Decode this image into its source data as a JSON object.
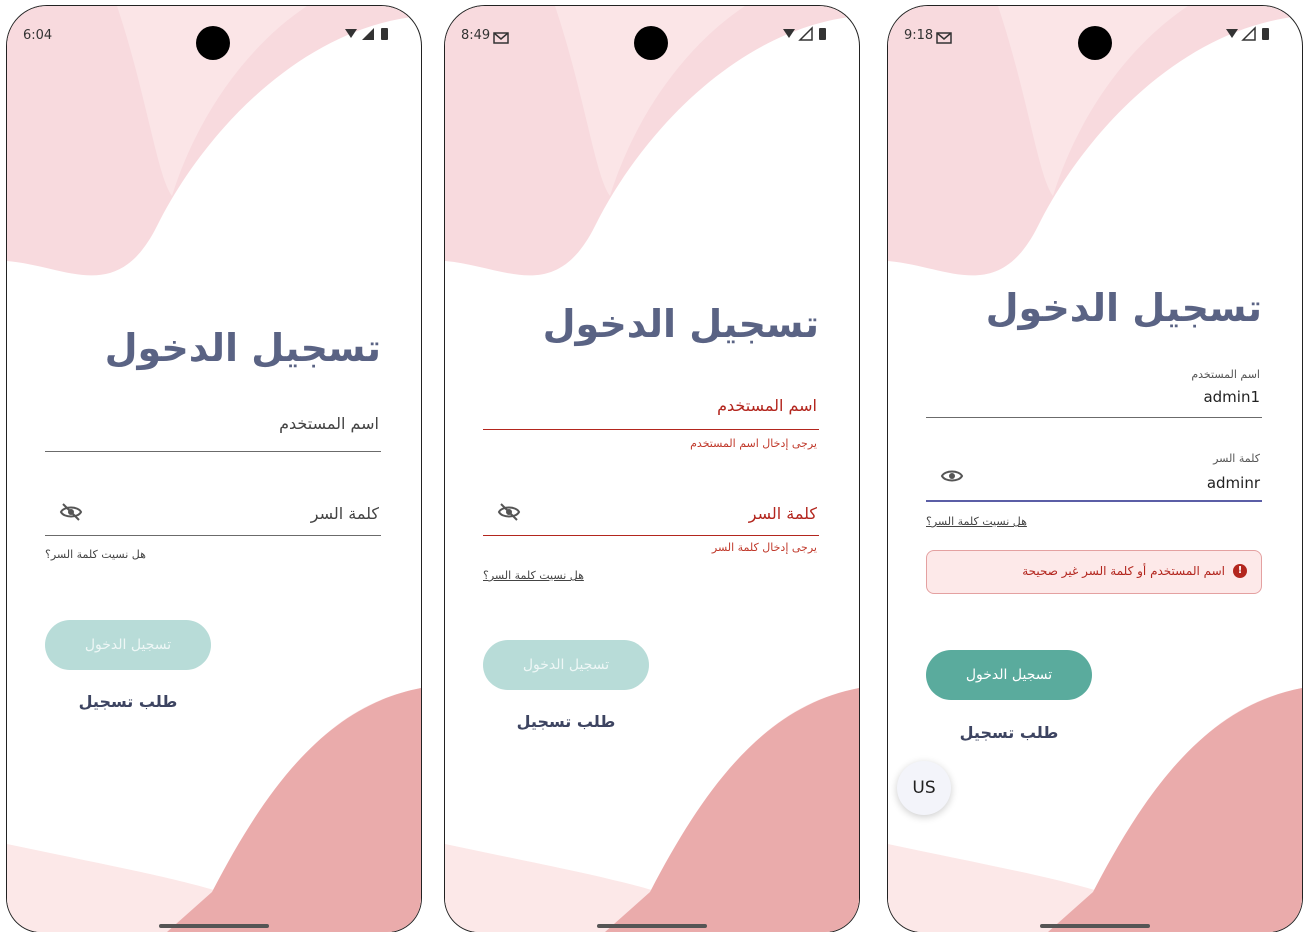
{
  "colors": {
    "title": "#5a6384",
    "error": "#b3261e",
    "button_disabled": "#b8dcd8",
    "button_enabled": "#5aab9d",
    "wave_top": "#f8dade",
    "wave_bottom": "#eaabab"
  },
  "screens": [
    {
      "time": "6:04",
      "title": "تسجيل الدخول",
      "username_label": "اسم المستخدم",
      "password_label": "كلمة السر",
      "password_icon": "eye-off-icon",
      "forgot": "هل نسيت كلمة السر؟",
      "login_button": "تسجيل الدخول",
      "register": "طلب تسجيل"
    },
    {
      "time": "8:49",
      "title": "تسجيل الدخول",
      "username_label": "اسم المستخدم",
      "username_error": "يرجى إدخال اسم المستخدم",
      "password_label": "كلمة السر",
      "password_error": "يرجى إدخال كلمة السر",
      "password_icon": "eye-off-icon",
      "forgot": "هل نسيت كلمة السر؟",
      "login_button": "تسجيل الدخول",
      "register": "طلب تسجيل"
    },
    {
      "time": "9:18",
      "title": "تسجيل الدخول",
      "username_label": "اسم المستخدم",
      "username_value": "admin1",
      "password_label": "كلمة السر",
      "password_value": "adminr",
      "password_icon": "eye-icon",
      "forgot": "هل نسيت كلمة السر؟",
      "alert": "اسم المستخدم أو كلمة السر غير صحيحة",
      "login_button": "تسجيل الدخول",
      "register": "طلب تسجيل",
      "lang_button": "US"
    }
  ]
}
